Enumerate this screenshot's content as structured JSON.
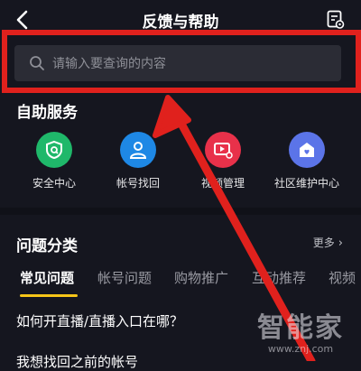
{
  "header": {
    "title": "反馈与帮助",
    "back_icon": "chevron-left-icon",
    "doc_icon": "document-settings-icon"
  },
  "search": {
    "placeholder": "请输入要查询的内容",
    "icon": "search-icon"
  },
  "self_service": {
    "title": "自助服务",
    "items": [
      {
        "label": "安全中心",
        "icon": "shield-icon",
        "color": "#1fb86a"
      },
      {
        "label": "帐号找回",
        "icon": "user-icon",
        "color": "#1e88e5"
      },
      {
        "label": "视频管理",
        "icon": "video-settings-icon",
        "color": "#e8314a"
      },
      {
        "label": "社区维护中心",
        "icon": "community-heart-icon",
        "color": "#5b74e8"
      }
    ]
  },
  "categories": {
    "title": "问题分类",
    "more_label": "更多",
    "tabs": [
      {
        "label": "常见问题",
        "active": true
      },
      {
        "label": "帐号问题",
        "active": false
      },
      {
        "label": "购物推广",
        "active": false
      },
      {
        "label": "互动推荐",
        "active": false
      },
      {
        "label": "视频",
        "active": false
      }
    ]
  },
  "faq": [
    {
      "text": "如何开直播/直播入口在哪？"
    },
    {
      "text": "我想找回之前的帐号"
    }
  ],
  "watermark": {
    "name": "智能家",
    "url": "www.znj.com"
  },
  "colors": {
    "background": "#15161f",
    "highlight": "#e0211d",
    "accent": "#f5c518",
    "search_bg": "#2b2c35"
  }
}
